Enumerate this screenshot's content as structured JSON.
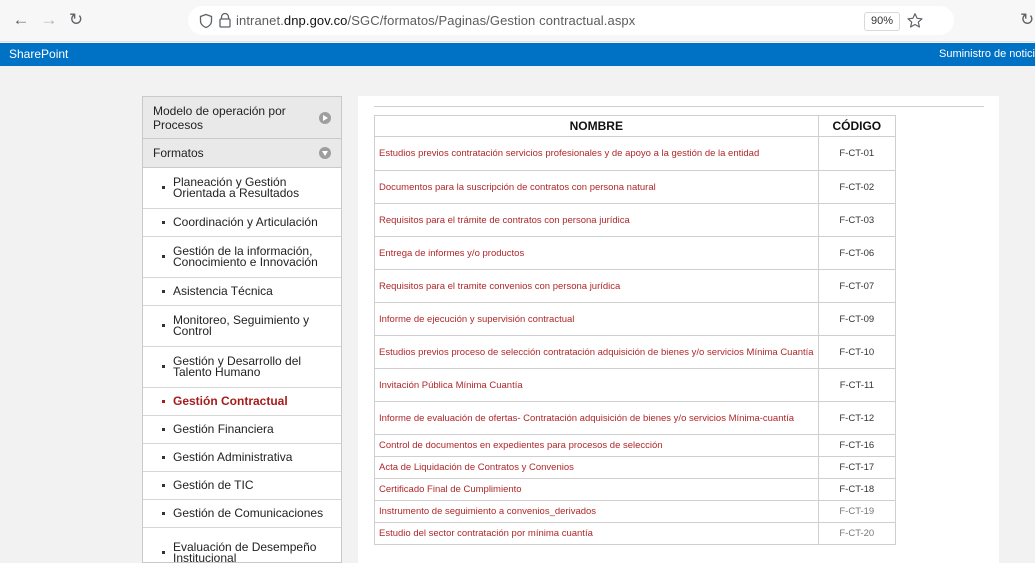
{
  "browser": {
    "url_prefix": "intranet.",
    "url_host": "dnp.gov.co",
    "url_path": "/SGC/formatos/Paginas/Gestion contractual.aspx",
    "zoom": "90%"
  },
  "sharepoint": {
    "brand": "SharePoint",
    "right_link": "Suministro de notici"
  },
  "sidebar": {
    "section1": "Modelo de operación por Procesos",
    "section2": "Formatos",
    "items": [
      {
        "label": "Planeación y Gestión Orientada a Resultados",
        "active": false
      },
      {
        "label": "Coordinación y Articulación",
        "active": false
      },
      {
        "label": "Gestión de la información, Conocimiento e Innovación",
        "active": false
      },
      {
        "label": "Asistencia Técnica",
        "active": false
      },
      {
        "label": "Monitoreo, Seguimiento y Control",
        "active": false
      },
      {
        "label": "Gestión y Desarrollo del Talento Humano",
        "active": false
      },
      {
        "label": "Gestión Contractual",
        "active": true
      },
      {
        "label": "Gestión Financiera",
        "active": false
      },
      {
        "label": "Gestión Administrativa",
        "active": false
      },
      {
        "label": "Gestión de TIC",
        "active": false
      },
      {
        "label": "Gestión de Comunicaciones",
        "active": false
      },
      {
        "label": "Evaluación de Desempeño Institucional",
        "active": false
      }
    ]
  },
  "table": {
    "headers": {
      "name": "NOMBRE",
      "code": "CÓDIGO"
    },
    "rows": [
      {
        "name": "Estudios previos contratación servicios profesionales y de apoyo a la gestión de la entidad",
        "code": "F-CT-01",
        "muted": false
      },
      {
        "name": "Documentos para la suscripción de contratos con persona natural",
        "code": "F-CT-02",
        "muted": false
      },
      {
        "name": "Requisitos para el trámite de contratos con persona jurídica",
        "code": "F-CT-03",
        "muted": false
      },
      {
        "name": "Entrega de informes y/o productos",
        "code": "F-CT-06",
        "muted": false
      },
      {
        "name": "Requisitos para el tramite convenios con persona jurídica",
        "code": "F-CT-07",
        "muted": false
      },
      {
        "name": "Informe de ejecución y supervisión contractual",
        "code": "F-CT-09",
        "muted": false
      },
      {
        "name": "Estudios previos proceso de selección contratación adquisición de bienes y/o servicios Mínima Cuantía",
        "code": "F-CT-10",
        "muted": false
      },
      {
        "name": "Invitación Pública Mínima Cuantía",
        "code": "F-CT-11",
        "muted": false
      },
      {
        "name": "Informe de evaluación de ofertas- Contratación adquisición de bienes y/o servicios Mínima-cuantía",
        "code": "F-CT-12",
        "muted": false
      },
      {
        "name": "Control de documentos en expedientes para procesos de selección",
        "code": "F-CT-16",
        "muted": false
      },
      {
        "name": "Acta de Liquidación de Contratos y Convenios",
        "code": "F-CT-17",
        "muted": false
      },
      {
        "name": "Certificado Final de Cumplimiento",
        "code": "F-CT-18",
        "muted": false
      },
      {
        "name": "Instrumento de seguimiento a convenios_derivados",
        "code": "F-CT-19",
        "muted": true
      },
      {
        "name": "Estudio del sector contratación por mínima cuantía",
        "code": "F-CT-20",
        "muted": true
      }
    ]
  }
}
